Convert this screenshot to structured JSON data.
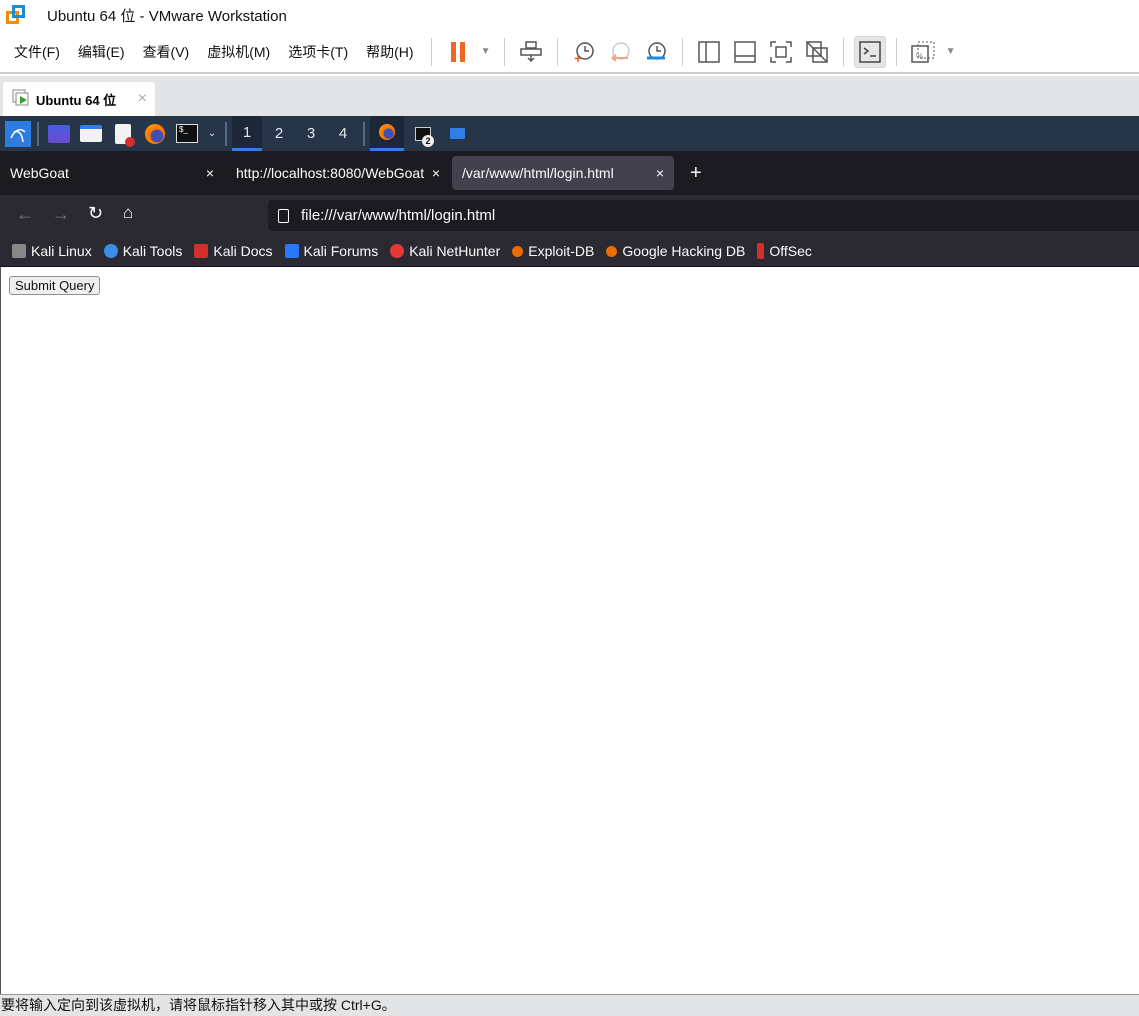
{
  "window": {
    "title": "Ubuntu 64 位 - VMware Workstation"
  },
  "menu": [
    "文件(F)",
    "编辑(E)",
    "查看(V)",
    "虚拟机(M)",
    "选项卡(T)",
    "帮助(H)"
  ],
  "vm_tab": {
    "label": "Ubuntu 64 位"
  },
  "kali_panel": {
    "workspaces": [
      "1",
      "2",
      "3",
      "4"
    ],
    "terminal_badge": "2"
  },
  "browser": {
    "tabs": [
      {
        "label": "WebGoat"
      },
      {
        "label": "http://localhost:8080/WebGoat"
      },
      {
        "label": "/var/www/html/login.html"
      }
    ],
    "new_tab": "+",
    "close": "×",
    "url": "file:///var/www/html/login.html",
    "bookmarks": [
      {
        "label": "Kali Linux",
        "color": "#cccccc"
      },
      {
        "label": "Kali Tools",
        "color": "#3a8ee6"
      },
      {
        "label": "Kali Docs",
        "color": "#d32f2f"
      },
      {
        "label": "Kali Forums",
        "color": "#2979ff"
      },
      {
        "label": "Kali NetHunter",
        "color": "#e53935"
      },
      {
        "label": "Exploit-DB",
        "color": "#ef6c00"
      },
      {
        "label": "Google Hacking DB",
        "color": "#ef6c00"
      },
      {
        "label": "OffSec",
        "color": "#d32f2f"
      }
    ]
  },
  "page": {
    "submit_label": "Submit Query"
  },
  "status": {
    "text": "要将输入定向到该虚拟机，请将鼠标指针移入其中或按 Ctrl+G。"
  }
}
